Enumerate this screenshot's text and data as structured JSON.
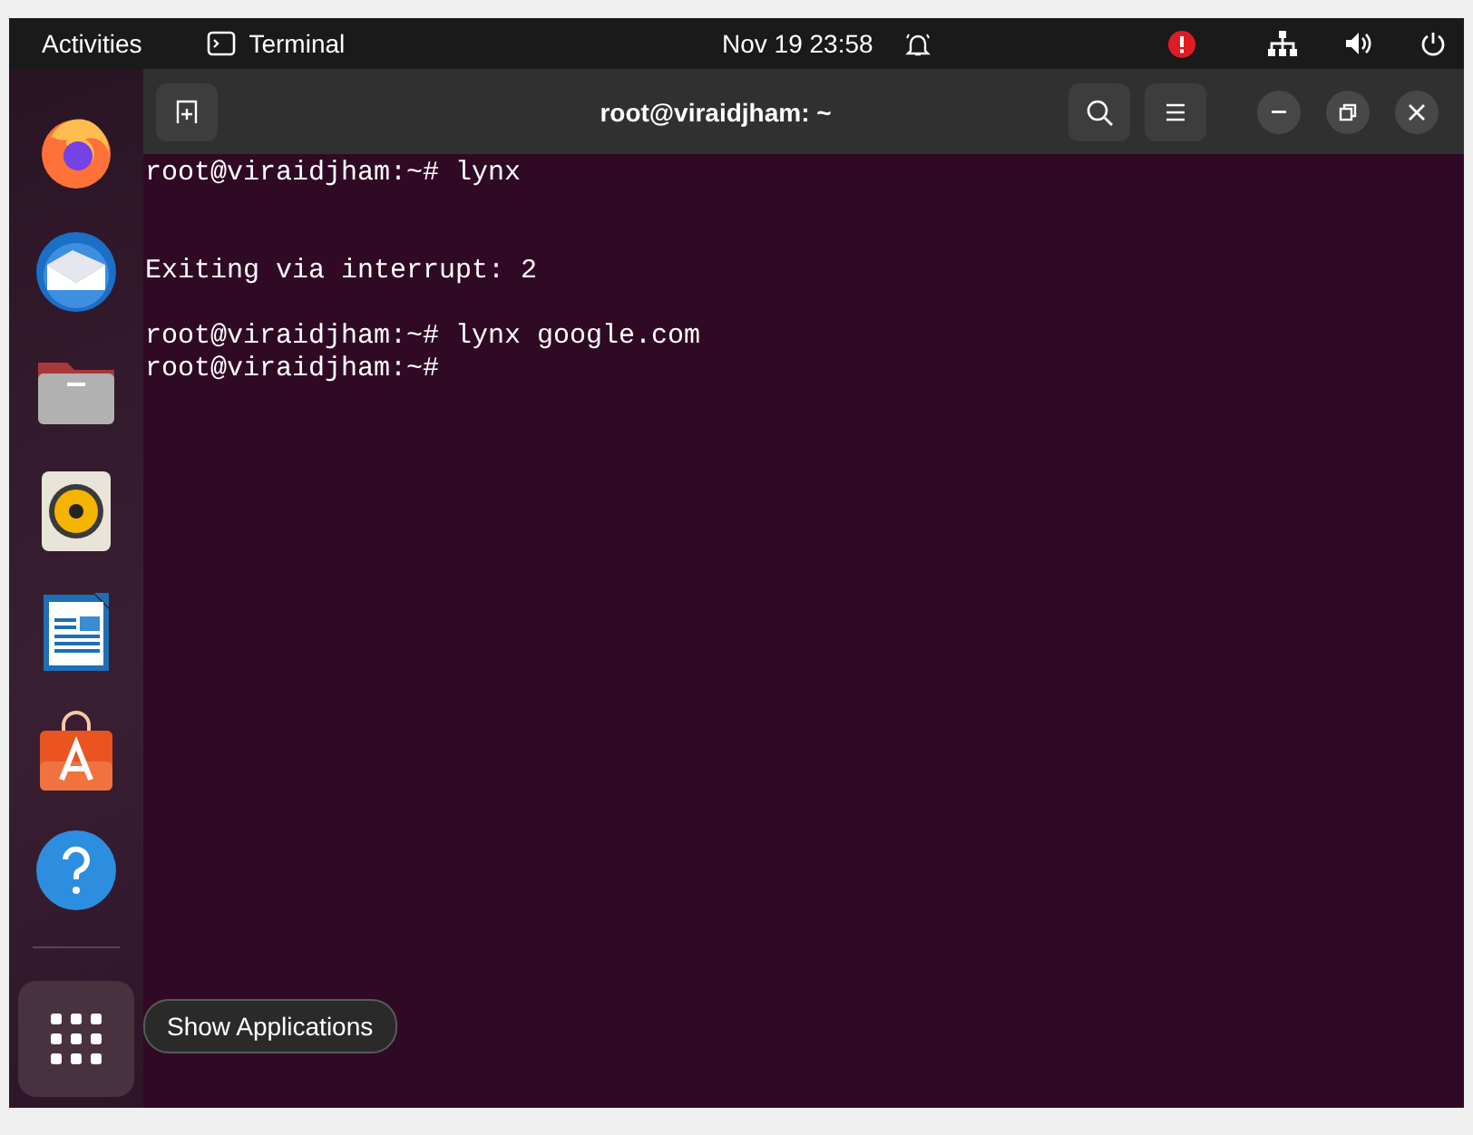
{
  "top_bar": {
    "activities": "Activities",
    "app_name": "Terminal",
    "date": "Nov 19",
    "time": "23:58",
    "alert": true
  },
  "dock": {
    "apps": [
      {
        "kind": "browser"
      },
      {
        "kind": "mail"
      },
      {
        "kind": "files"
      },
      {
        "kind": "music"
      },
      {
        "kind": "writer"
      },
      {
        "kind": "store"
      },
      {
        "kind": "help"
      }
    ],
    "show_apps_tooltip": "Show Applications"
  },
  "window": {
    "title": "root@viraidjham: ~",
    "lines": [
      {
        "kind": "text",
        "text": "root@viraidjham:~# lynx"
      },
      {
        "kind": "blank"
      },
      {
        "kind": "blank"
      },
      {
        "kind": "text",
        "text": "Exiting via interrupt: 2"
      },
      {
        "kind": "blank"
      },
      {
        "kind": "text",
        "text": "root@viraidjham:~# lynx google.com"
      },
      {
        "kind": "text",
        "text": "root@viraidjham:~#"
      }
    ]
  }
}
